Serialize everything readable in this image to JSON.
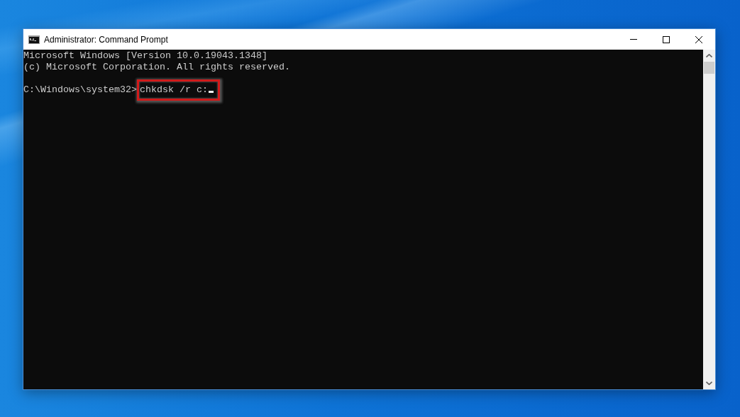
{
  "window": {
    "title": "Administrator: Command Prompt"
  },
  "console": {
    "output": [
      "Microsoft Windows [Version 10.0.19043.1348]",
      "(c) Microsoft Corporation. All rights reserved."
    ],
    "prompt": {
      "path": "C:\\Windows\\system32>",
      "command": "chkdsk /r c:",
      "highlighted": true,
      "cursor": true
    }
  }
}
